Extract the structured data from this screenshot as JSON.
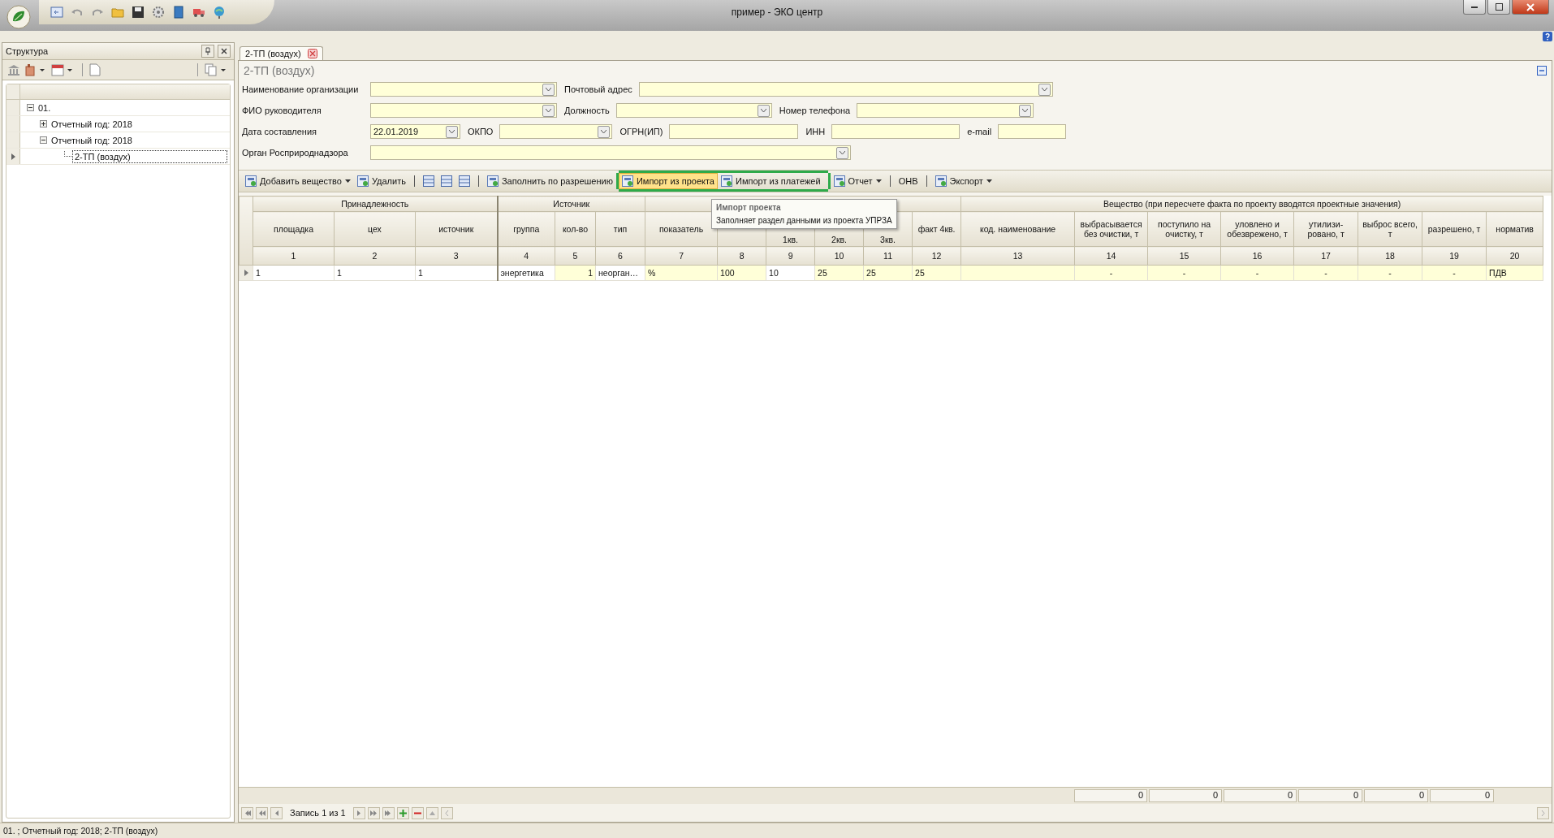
{
  "window": {
    "title": "пример - ЭКО центр"
  },
  "structure_panel": {
    "title": "Структура",
    "tree": [
      {
        "label": "01.",
        "expanded": true,
        "selected": false,
        "children": [
          {
            "label": "Отчетный год: 2018",
            "expanded": false,
            "selected": false
          },
          {
            "label": "Отчетный год: 2018",
            "expanded": true,
            "selected": false,
            "children": [
              {
                "label": "2-ТП (воздух)",
                "selected": true
              }
            ]
          }
        ]
      }
    ]
  },
  "tabs": [
    {
      "label": "2-ТП (воздух)",
      "selected": true
    }
  ],
  "document_title": "2-ТП (воздух)",
  "form": {
    "fields": [
      {
        "label": "Наименование организации",
        "kind": "combo"
      },
      {
        "label": "Почтовый адрес",
        "kind": "combo"
      },
      {
        "label": "ФИО руководителя",
        "kind": "combo"
      },
      {
        "label": "Должность",
        "kind": "combo"
      },
      {
        "label": "Номер телефона",
        "kind": "combo"
      },
      {
        "label": "Дата составления",
        "kind": "combo",
        "value": "22.01.2019"
      },
      {
        "label": "ОКПО",
        "kind": "combo"
      },
      {
        "label": "ОГРН(ИП)",
        "kind": "text"
      },
      {
        "label": "ИНН",
        "kind": "text"
      },
      {
        "label": "e-mail",
        "kind": "text"
      },
      {
        "label": "Орган Росприроднадзора",
        "kind": "combo"
      }
    ]
  },
  "toolbar": [
    {
      "kind": "button",
      "label": "Добавить вещество",
      "dropdown": true,
      "hovered": false
    },
    {
      "kind": "button",
      "label": "Удалить",
      "dropdown": false,
      "hovered": false
    },
    {
      "kind": "separator"
    },
    {
      "kind": "icon"
    },
    {
      "kind": "icon"
    },
    {
      "kind": "icon"
    },
    {
      "kind": "separator"
    },
    {
      "kind": "button",
      "label": "Заполнить по разрешению",
      "dropdown": false,
      "hovered": false
    },
    {
      "kind": "button",
      "label": "Импорт из проекта",
      "dropdown": false,
      "hovered": true,
      "outlined": true
    },
    {
      "kind": "button",
      "label": "Импорт из платежей",
      "dropdown": false,
      "hovered": false,
      "outlined": true
    },
    {
      "kind": "button",
      "label": "Отчет",
      "dropdown": true,
      "hovered": false
    },
    {
      "kind": "separator"
    },
    {
      "kind": "text",
      "label": "ОНВ"
    },
    {
      "kind": "separator"
    },
    {
      "kind": "button",
      "label": "Экспорт",
      "dropdown": true,
      "hovered": false
    }
  ],
  "tooltip": {
    "title": "Импорт проекта",
    "text": "Заполняет раздел данными из проекта УПРЗА"
  },
  "table": {
    "groups": [
      {
        "label": "Принадлежность"
      },
      {
        "label": "Источник"
      },
      {
        "label": "Вещество (при пересчете факта по проекту вводятся проектные значения)"
      }
    ],
    "columns": [
      {
        "label": "площадка",
        "number": "1"
      },
      {
        "label": "цех",
        "number": "2"
      },
      {
        "label": "источник",
        "number": "3"
      },
      {
        "label": "группа",
        "number": "4"
      },
      {
        "label": "кол-во",
        "number": "5"
      },
      {
        "label": "тип",
        "number": "6"
      },
      {
        "label": "показатель",
        "number": "7"
      },
      {
        "number": "8"
      },
      {
        "label": "1кв.",
        "number": "9"
      },
      {
        "label": "2кв.",
        "number": "10"
      },
      {
        "label": "3кв.",
        "number": "11"
      },
      {
        "label": "факт 4кв.",
        "number": "12"
      },
      {
        "label": "код. наименование",
        "number": "13"
      },
      {
        "label": "выбрасывается без очистки, т",
        "number": "14"
      },
      {
        "label": "поступило на очистку, т",
        "number": "15"
      },
      {
        "label": "уловлено и обезврежено, т",
        "number": "16"
      },
      {
        "label": "утилизи-ровано, т",
        "number": "17"
      },
      {
        "label": "выброс всего, т",
        "number": "18"
      },
      {
        "label": "разрешено, т",
        "number": "19"
      },
      {
        "label": "норматив",
        "number": "20"
      }
    ],
    "rows": [
      {
        "selected": true,
        "cells": [
          {
            "text": "1",
            "highlighted": false
          },
          {
            "text": "1",
            "highlighted": false
          },
          {
            "text": "1",
            "highlighted": false
          },
          {
            "text": "энергетика",
            "highlighted": false
          },
          {
            "text": "1",
            "highlighted": true
          },
          {
            "text": "неорган…",
            "highlighted": false
          },
          {
            "text": "%",
            "highlighted": true
          },
          {
            "text": "100",
            "highlighted": true
          },
          {
            "text": "10",
            "highlighted": false
          },
          {
            "text": "25",
            "highlighted": true
          },
          {
            "text": "25",
            "highlighted": true
          },
          {
            "text": "25",
            "highlighted": true
          },
          {
            "highlighted": true
          },
          {
            "text": "-",
            "highlighted": true
          },
          {
            "text": "-",
            "highlighted": true
          },
          {
            "text": "-",
            "highlighted": true
          },
          {
            "text": "-",
            "highlighted": true
          },
          {
            "text": "-",
            "highlighted": true
          },
          {
            "text": "-",
            "highlighted": true
          },
          {
            "text": "ПДВ",
            "highlighted": true
          }
        ]
      }
    ],
    "totals": [
      "0",
      "0",
      "0",
      "0",
      "0",
      "0"
    ]
  },
  "navigator": {
    "record": "Запись 1 из 1"
  },
  "status_bar": "01. ; Отчетный год: 2018; 2-ТП (воздух)"
}
